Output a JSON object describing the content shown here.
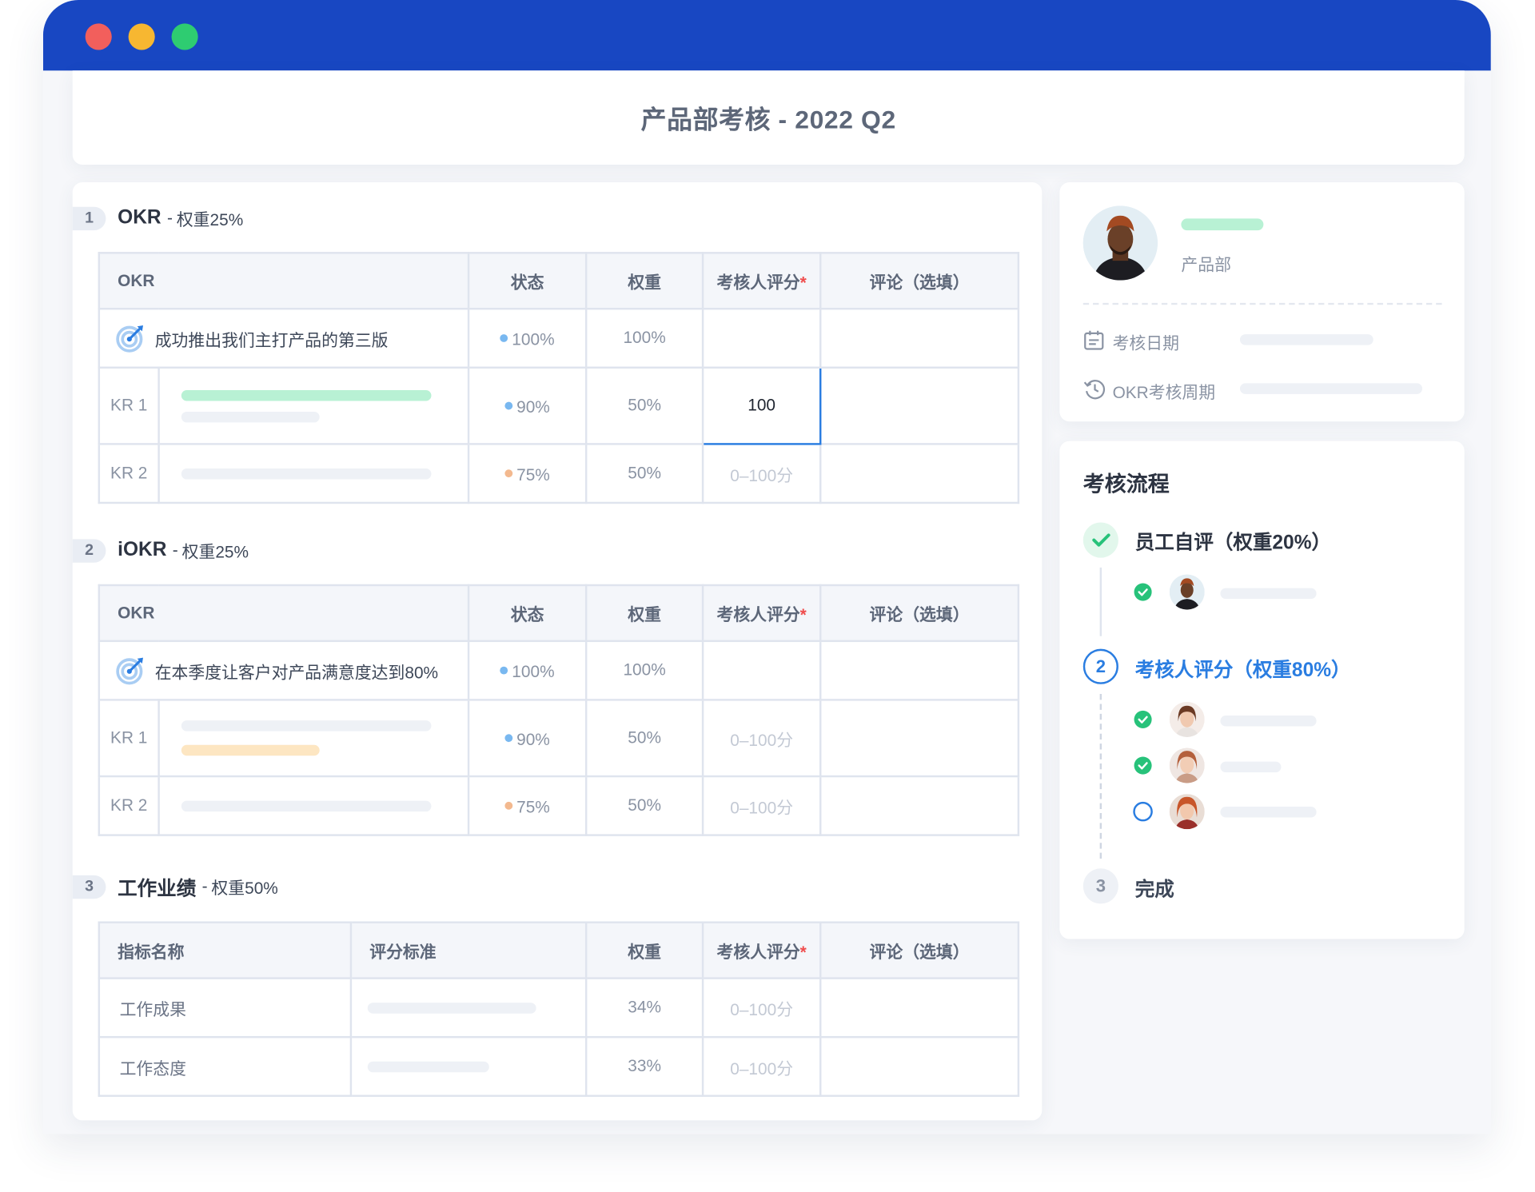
{
  "window": {
    "controls": [
      "close",
      "minimize",
      "maximize"
    ]
  },
  "page": {
    "title": "产品部考核 - 2022 Q2"
  },
  "okr_section": {
    "number": "1",
    "title": "OKR",
    "sep": "-",
    "weight": "权重25%",
    "headers": {
      "okr": "OKR",
      "status": "状态",
      "weight": "权重",
      "score": "考核人评分",
      "star": "*",
      "comment": "评论（选填）"
    },
    "objective": {
      "text": "成功推出我们主打产品的第三版",
      "status": "100%",
      "weight": "100%"
    },
    "kr1": {
      "label": "KR 1",
      "status": "90%",
      "weight": "50%",
      "score": "100"
    },
    "kr2": {
      "label": "KR 2",
      "status": "75%",
      "weight": "50%",
      "score_placeholder": "0–100分"
    }
  },
  "iokr_section": {
    "number": "2",
    "title": "iOKR",
    "sep": "-",
    "weight": "权重25%",
    "headers": {
      "okr": "OKR",
      "status": "状态",
      "weight": "权重",
      "score": "考核人评分",
      "star": "*",
      "comment": "评论（选填）"
    },
    "objective": {
      "text": "在本季度让客户对产品满意度达到80%",
      "status": "100%",
      "weight": "100%"
    },
    "kr1": {
      "label": "KR 1",
      "status": "90%",
      "weight": "50%",
      "score_placeholder": "0–100分"
    },
    "kr2": {
      "label": "KR 2",
      "status": "75%",
      "weight": "50%",
      "score_placeholder": "0–100分"
    }
  },
  "work_section": {
    "number": "3",
    "title": "工作业绩",
    "sep": "-",
    "weight": "权重50%",
    "headers": {
      "name": "指标名称",
      "criteria": "评分标准",
      "weight": "权重",
      "score": "考核人评分",
      "star": "*",
      "comment": "评论（选填）"
    },
    "rows": [
      {
        "name": "工作成果",
        "weight": "34%",
        "score_placeholder": "0–100分"
      },
      {
        "name": "工作态度",
        "weight": "33%",
        "score_placeholder": "0–100分"
      }
    ]
  },
  "profile": {
    "department": "产品部",
    "review_date_label": "考核日期",
    "okr_cycle_label": "OKR考核周期"
  },
  "process": {
    "title": "考核流程",
    "steps": [
      {
        "label": "员工自评（权重20%）",
        "state": "done"
      },
      {
        "number": "2",
        "label": "考核人评分（权重80%）",
        "state": "active"
      },
      {
        "number": "3",
        "label": "完成",
        "state": "pending"
      }
    ]
  },
  "colors": {
    "titlebar": "#1847c2",
    "accent_blue": "#2a7de1",
    "success_green": "#27c27a",
    "status_blue": "#79b8f0",
    "status_orange": "#f3b98f",
    "bar_green": "#b8f1d4",
    "bar_gray": "#eef1f6",
    "bar_orange": "#fde6c2",
    "required_red": "#ef4d4d"
  }
}
